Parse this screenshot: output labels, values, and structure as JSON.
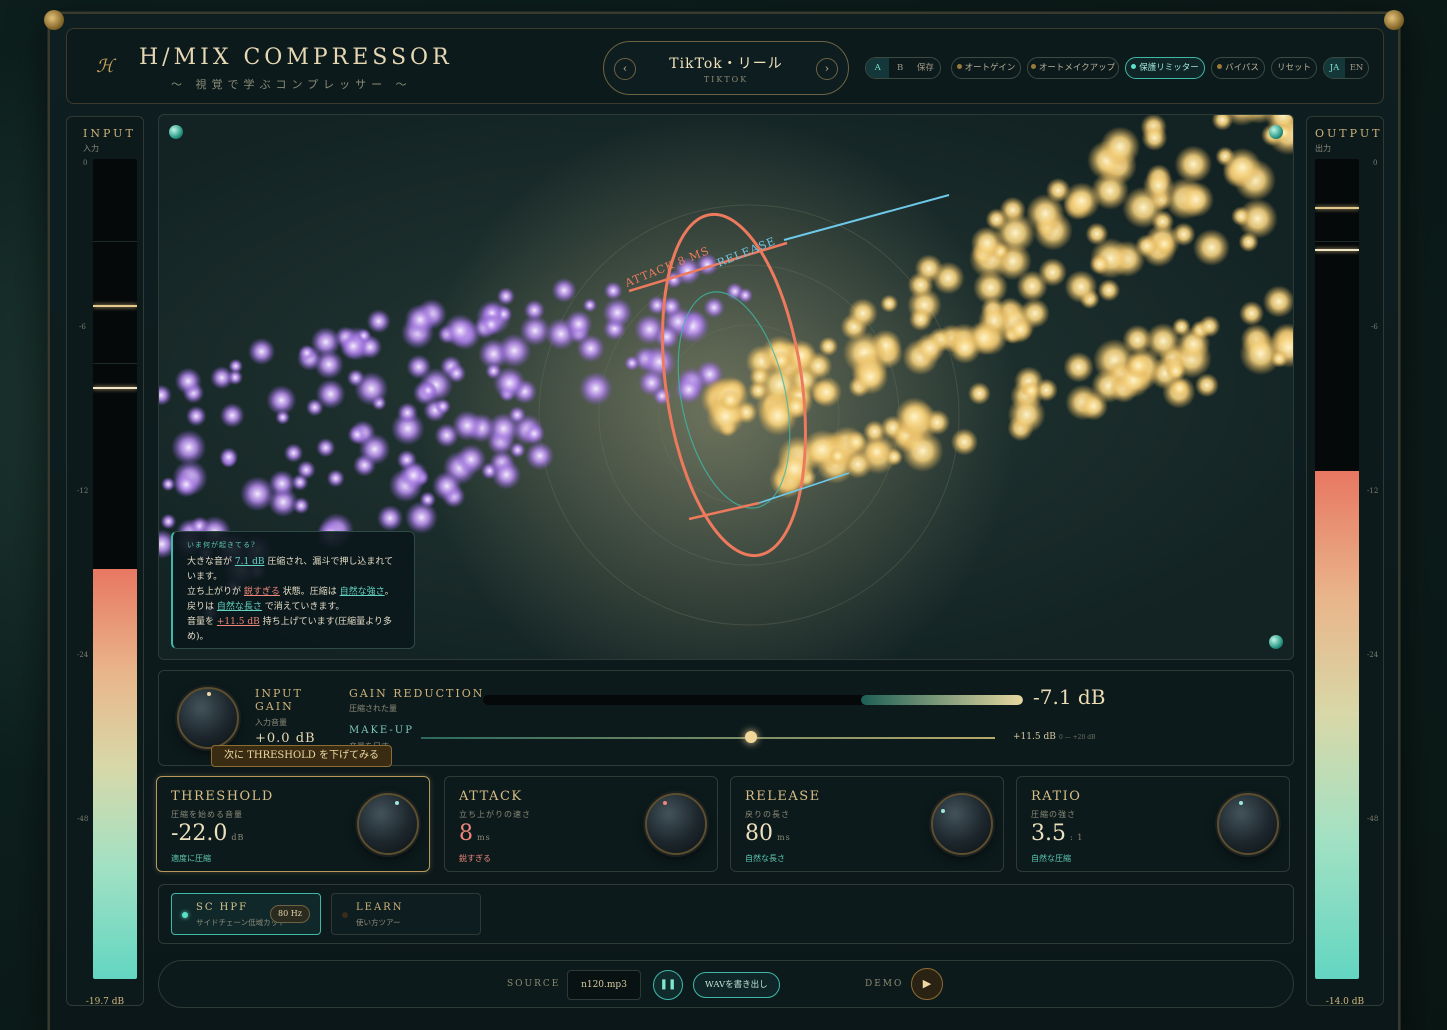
{
  "header": {
    "title": "H/MIX COMPRESSOR",
    "subtitle": "〜 視覚で学ぶコンプレッサー 〜",
    "preset_name": "TikTok・リール",
    "preset_sub": "TIKTOK",
    "ab": [
      "A",
      "B"
    ],
    "save_label": "保存",
    "buttons": [
      {
        "label": "オートゲイン",
        "active": false
      },
      {
        "label": "オートメイクアップ",
        "active": false
      },
      {
        "label": "保護リミッター",
        "active": true
      },
      {
        "label": "バイパス",
        "active": false
      },
      {
        "label": "リセット",
        "active": false
      }
    ],
    "lang": [
      "JA",
      "EN"
    ],
    "lang_selected": "JA"
  },
  "input_meter": {
    "title": "INPUT",
    "sub": "入力",
    "ticks": [
      "0",
      "-6",
      "-12",
      "-24",
      "-48"
    ],
    "value_label": "-19.7 dB",
    "level_fraction": 0.5
  },
  "output_meter": {
    "title": "OUTPUT",
    "sub": "出力",
    "ticks": [
      "0",
      "-6",
      "-12",
      "-24",
      "-48"
    ],
    "value_label": "-14.0 dB",
    "level_fraction": 0.62
  },
  "visualizer": {
    "ring_label_attack": "ATTACK 8 MS",
    "ring_label_release": "RELEASE",
    "explain_heading": "いま何が起きてる?",
    "explain": {
      "l1a": "大きな音が",
      "l1v": "7.1 dB",
      "l1b": "圧縮され、漏斗で押し込まれています。",
      "l2a": "立ち上がりが",
      "l2v": "鋭すぎる",
      "l2b": "状態。圧縮は",
      "l2v2": "自然な強さ",
      "l2c": "。戻りは",
      "l2v3": "自然な長さ",
      "l2d": "で消えていきます。",
      "l3a": "音量を",
      "l3v": "+11.5 dB",
      "l3b": "持ち上げています(圧縮量より多め)。"
    }
  },
  "gain": {
    "input_gain_label": "INPUT GAIN",
    "input_gain_sub": "入力音量",
    "input_gain_value": "+0.0 dB",
    "gr_label": "GAIN REDUCTION",
    "gr_sub": "圧縮された量",
    "gr_value": "-7.1 dB",
    "gr_fraction": 0.3,
    "makeup_label": "MAKE-UP",
    "makeup_sub": "音量を足す",
    "makeup_value": "+11.5 dB",
    "makeup_range": "0 — +20 dB",
    "makeup_fraction": 0.575,
    "hint": "次に THRESHOLD を下げてみる"
  },
  "params": [
    {
      "title": "THRESHOLD",
      "sub": "圧縮を始める音量",
      "value": "-22.0",
      "unit": "dB",
      "status": "適度に圧縮",
      "warn": false,
      "selected": true
    },
    {
      "title": "ATTACK",
      "sub": "立ち上がりの速さ",
      "value": "8",
      "unit": "ms",
      "status": "鋭すぎる",
      "warn": true,
      "selected": false
    },
    {
      "title": "RELEASE",
      "sub": "戻りの長さ",
      "value": "80",
      "unit": "ms",
      "status": "自然な長さ",
      "warn": false,
      "selected": false
    },
    {
      "title": "RATIO",
      "sub": "圧縮の強さ",
      "value": "3.5",
      "unit": ": 1",
      "status": "自然な圧縮",
      "warn": false,
      "selected": false
    }
  ],
  "sidechain": {
    "hpf_label": "SC HPF",
    "hpf_sub": "サイドチェーン低域カット",
    "hpf_freq": "80 Hz",
    "hpf_on": true,
    "learn_label": "LEARN",
    "learn_sub": "使い方ツアー",
    "learn_on": false
  },
  "transport": {
    "source_label": "SOURCE",
    "file": "n120.mp3",
    "play_icon": "pause-icon",
    "export_label": "WAVを書き出し",
    "demo_label": "DEMO",
    "demo_icon": "play-icon"
  },
  "colors": {
    "accent_gold": "#cdb27a",
    "accent_teal": "#5de0c8",
    "warn_red": "#f0857a"
  }
}
